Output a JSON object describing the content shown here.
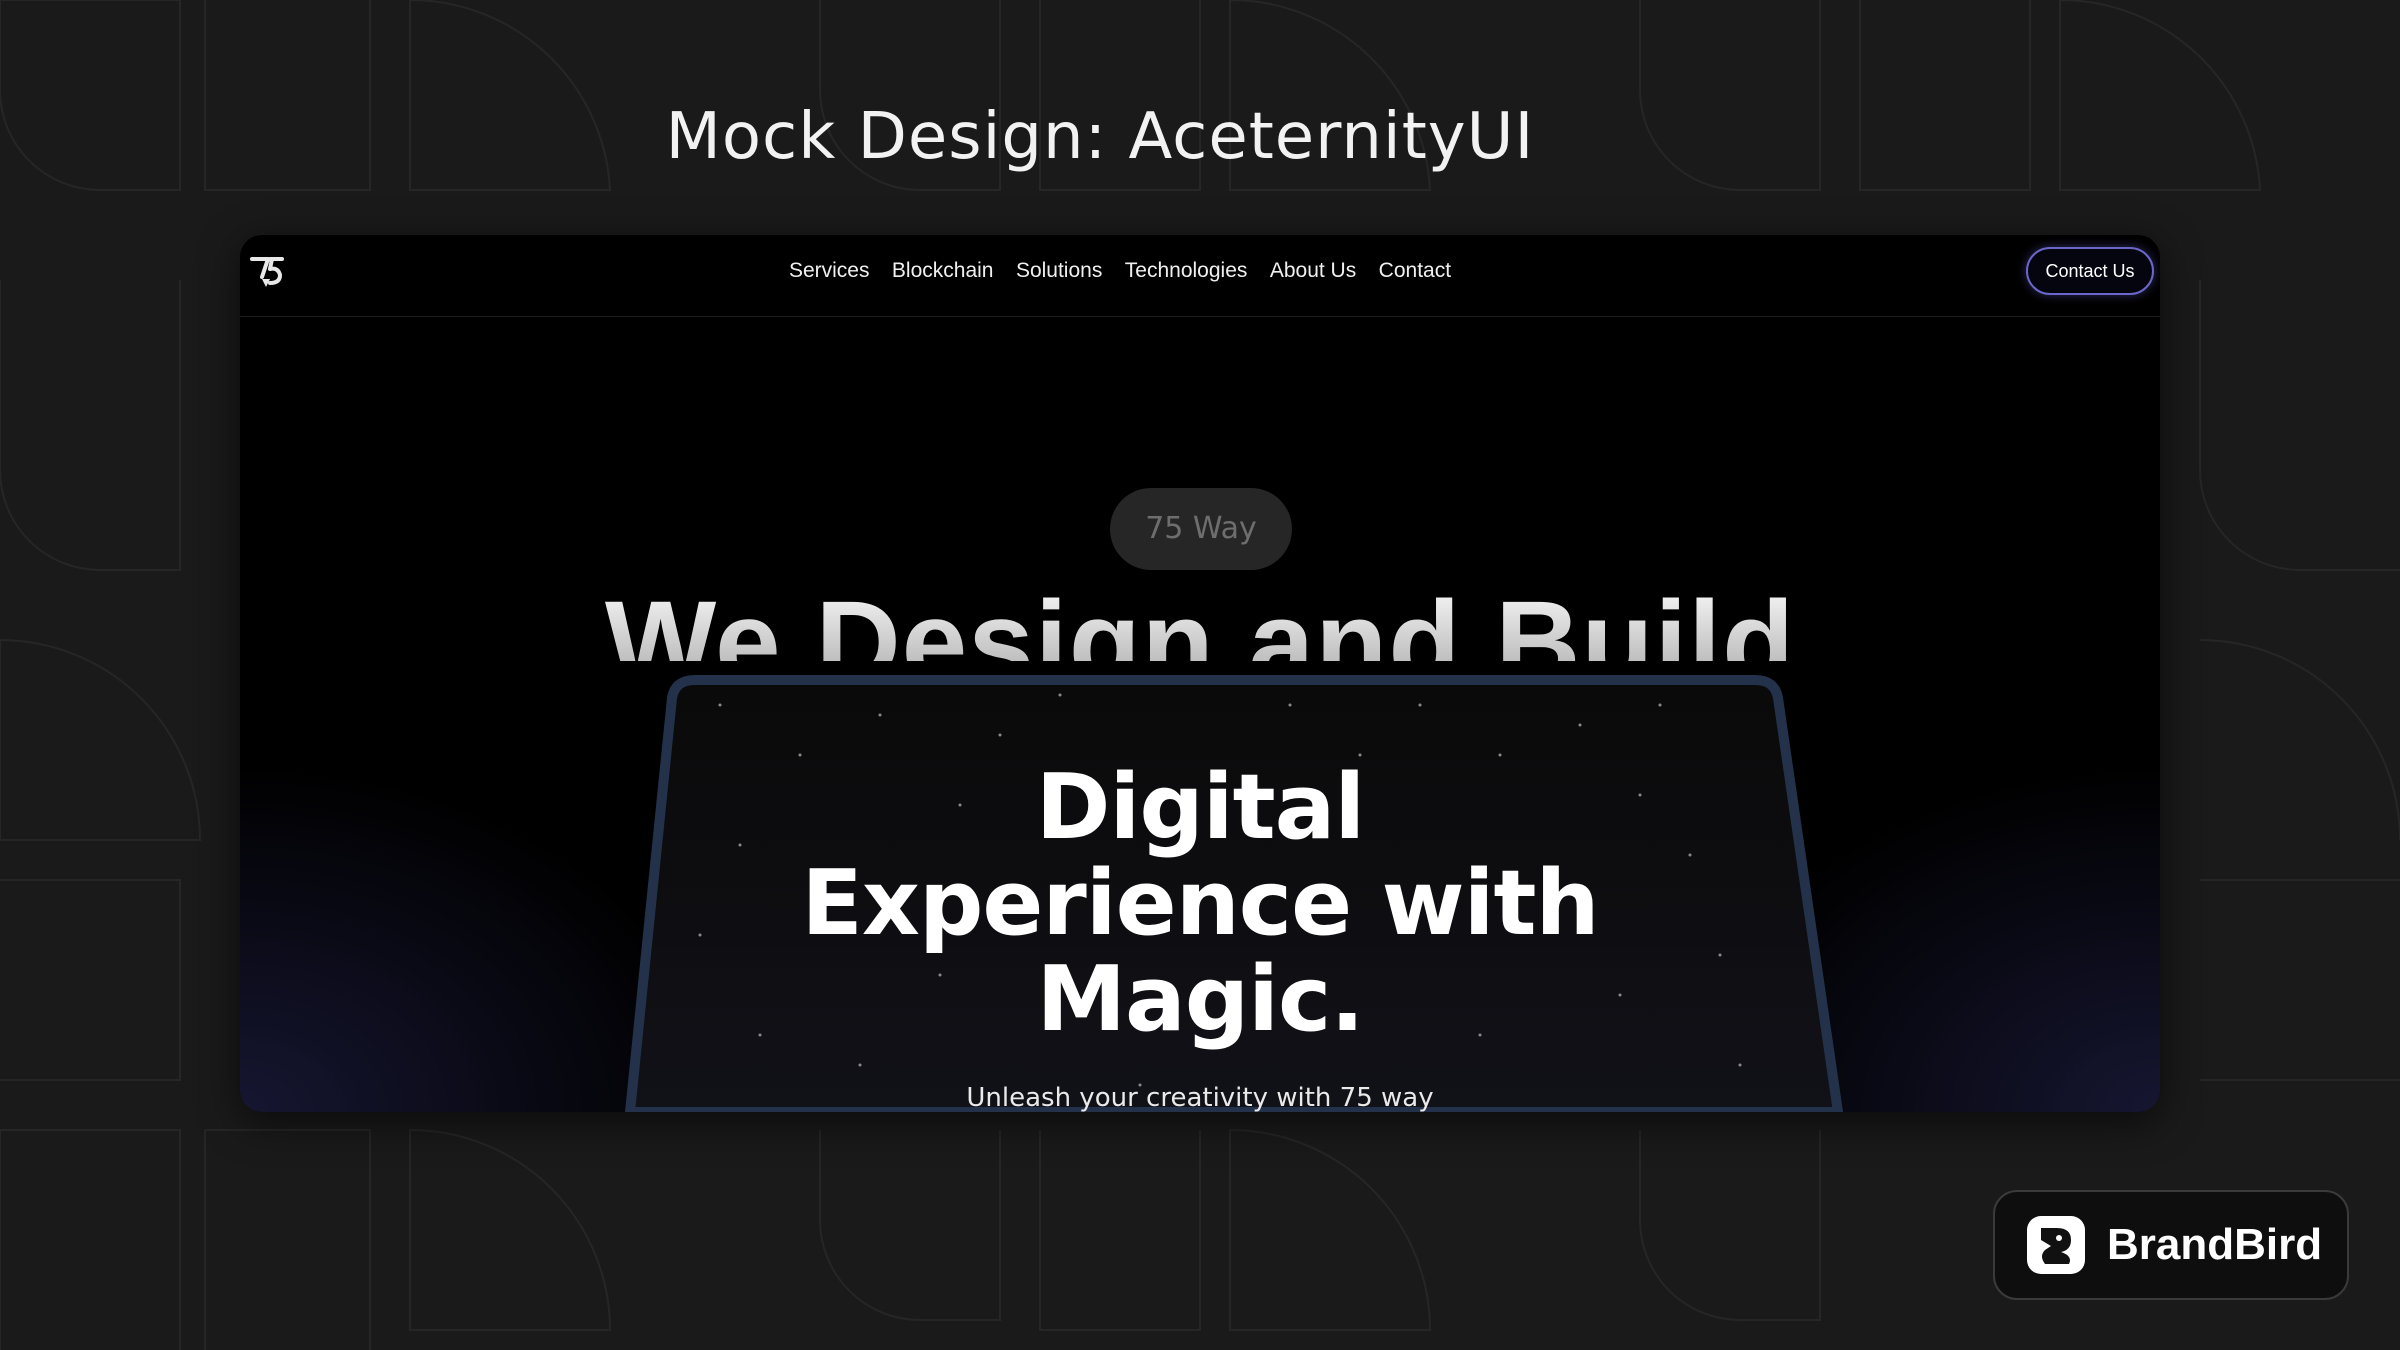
{
  "page_title": "Mock Design: AceternityUI",
  "site": {
    "logo_icon": "75way-logo-icon",
    "nav": [
      "Services",
      "Blockchain",
      "Solutions",
      "Technologies",
      "About Us",
      "Contact"
    ],
    "contact_button": "Contact Us",
    "badge": "75 Way",
    "headline": "We Design and Build",
    "screen_title_lines": [
      "Digital",
      "Experience with",
      "Magic."
    ],
    "screen_subtitle": "Unleash your creativity with 75 way"
  },
  "brand": {
    "name": "BrandBird",
    "icon": "brandbird-logo-icon"
  },
  "colors": {
    "background": "#1a1a1a",
    "frame_background": "#000000",
    "button_border": "#6b67c9",
    "screen_border": "#23324a"
  }
}
